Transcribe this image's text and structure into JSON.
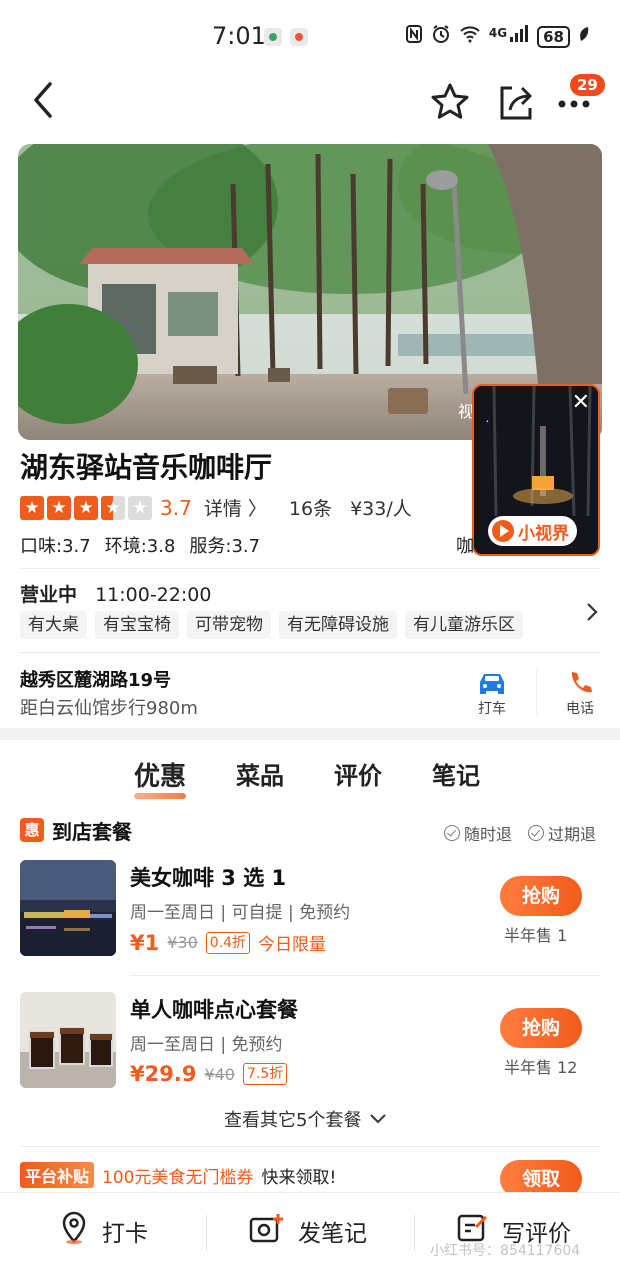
{
  "status_bar": {
    "time": "7:01",
    "network": "4G",
    "battery": "68"
  },
  "nav": {
    "badge_count": "29"
  },
  "hero": {
    "video_label": "视"
  },
  "mini_video": {
    "button_label": "小视界"
  },
  "shop": {
    "name": "湖东驿站音乐咖啡厅",
    "rating": "3.7",
    "rating_value": 3.5,
    "detail_label": "详情",
    "review_count": "16条",
    "price_per_person": "¥33/人",
    "taste": "口味:3.7",
    "environment": "环境:3.8",
    "service": "服务:3.7",
    "category": "咖",
    "status": "营业中",
    "hours": "11:00-22:00",
    "tags": [
      "有大桌",
      "有宝宝椅",
      "可带宠物",
      "有无障碍设施",
      "有儿童游乐区"
    ],
    "address": "越秀区麓湖路19号",
    "distance": "距白云仙馆步行980m"
  },
  "actions": {
    "taxi": "打车",
    "phone": "电话"
  },
  "tabs": [
    "优惠",
    "菜品",
    "评价",
    "笔记"
  ],
  "deals_section": {
    "icon_text": "惠",
    "title": "到店套餐",
    "policy_1": "随时退",
    "policy_2": "过期退",
    "deals": [
      {
        "name": "美女咖啡 3 选 1",
        "sub": "周一至周日 | 可自提 | 免预约",
        "price": "¥1",
        "original": "¥30",
        "discount": "0.4折",
        "limit": "今日限量",
        "buy": "抢购",
        "sold": "半年售 1"
      },
      {
        "name": "单人咖啡点心套餐",
        "sub": "周一至周日 | 免预约",
        "price": "¥29.9",
        "original": "¥40",
        "discount": "7.5折",
        "buy": "抢购",
        "sold": "半年售 12"
      }
    ],
    "more": "查看其它5个套餐"
  },
  "promo": {
    "tag": "平台补贴",
    "text": "100元美食无门槛券",
    "cta_text": "快来领取!",
    "button": "领取"
  },
  "bottom_bar": {
    "checkin": "打卡",
    "note": "发笔记",
    "review": "写评价"
  },
  "watermark": "小红书号：854117604",
  "colors": {
    "accent": "#f25b1a",
    "star_off": "#dddddd"
  }
}
